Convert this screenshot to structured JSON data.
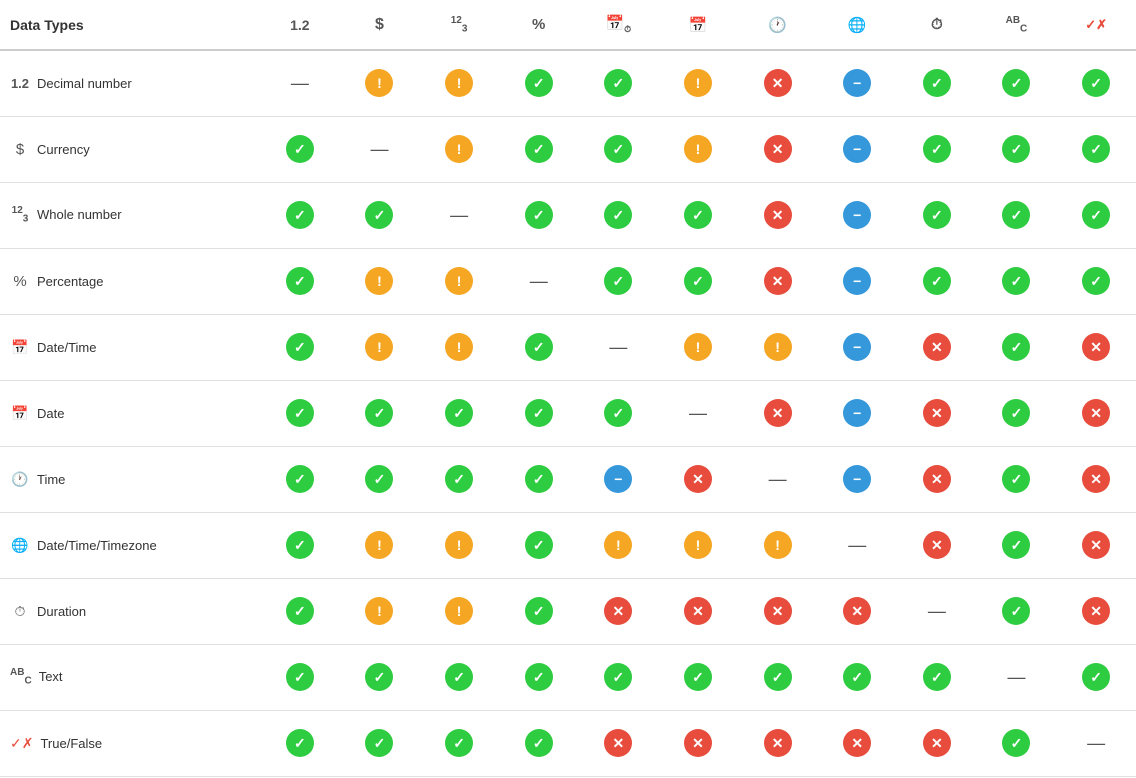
{
  "header": {
    "title": "Data Types",
    "columns": [
      {
        "id": "decimal",
        "label": "1.2",
        "icon": "1.2"
      },
      {
        "id": "currency",
        "label": "$",
        "icon": "$"
      },
      {
        "id": "whole",
        "label": "¹²₃",
        "icon": "123"
      },
      {
        "id": "percent",
        "label": "%",
        "icon": "%"
      },
      {
        "id": "datetime",
        "label": "🗓",
        "icon": "datetime"
      },
      {
        "id": "date",
        "label": "📅",
        "icon": "date"
      },
      {
        "id": "time",
        "label": "⏱",
        "icon": "time"
      },
      {
        "id": "tz",
        "label": "🌐",
        "icon": "tz"
      },
      {
        "id": "duration",
        "label": "⏱",
        "icon": "duration"
      },
      {
        "id": "text",
        "label": "ABC",
        "icon": "text"
      },
      {
        "id": "truefalse",
        "label": "✓✗",
        "icon": "truefalse"
      }
    ]
  },
  "rows": [
    {
      "id": "decimal",
      "icon": "decimal",
      "label": "Decimal number",
      "cells": [
        "dash",
        "yellow",
        "yellow",
        "green",
        "green",
        "yellow",
        "red",
        "blue",
        "green",
        "green",
        "green"
      ]
    },
    {
      "id": "currency",
      "icon": "currency",
      "label": "Currency",
      "cells": [
        "green",
        "dash",
        "yellow",
        "green",
        "green",
        "yellow",
        "red",
        "blue",
        "green",
        "green",
        "green"
      ]
    },
    {
      "id": "whole",
      "icon": "whole",
      "label": "Whole number",
      "cells": [
        "green",
        "green",
        "dash",
        "green",
        "green",
        "green",
        "red",
        "blue",
        "green",
        "green",
        "green"
      ]
    },
    {
      "id": "percentage",
      "icon": "percent",
      "label": "Percentage",
      "cells": [
        "green",
        "yellow",
        "yellow",
        "dash",
        "green",
        "green",
        "red",
        "blue",
        "green",
        "green",
        "green"
      ]
    },
    {
      "id": "datetime",
      "icon": "datetime",
      "label": "Date/Time",
      "cells": [
        "green",
        "yellow",
        "yellow",
        "green",
        "dash",
        "yellow",
        "yellow",
        "blue",
        "red",
        "green",
        "red"
      ]
    },
    {
      "id": "date",
      "icon": "date",
      "label": "Date",
      "cells": [
        "green",
        "green",
        "green",
        "green",
        "green",
        "dash",
        "red",
        "blue",
        "red",
        "green",
        "red"
      ]
    },
    {
      "id": "time",
      "icon": "time",
      "label": "Time",
      "cells": [
        "green",
        "green",
        "green",
        "green",
        "blue",
        "red",
        "dash",
        "blue",
        "red",
        "green",
        "red"
      ]
    },
    {
      "id": "tz",
      "icon": "tz",
      "label": "Date/Time/Timezone",
      "cells": [
        "green",
        "yellow",
        "yellow",
        "green",
        "yellow",
        "yellow",
        "yellow",
        "dash",
        "red",
        "green",
        "red"
      ]
    },
    {
      "id": "duration",
      "icon": "duration",
      "label": "Duration",
      "cells": [
        "green",
        "yellow",
        "yellow",
        "green",
        "red",
        "red",
        "red",
        "red",
        "dash",
        "green",
        "red"
      ]
    },
    {
      "id": "text",
      "icon": "text",
      "label": "Text",
      "cells": [
        "green",
        "green",
        "green",
        "green",
        "green",
        "green",
        "green",
        "green",
        "green",
        "dash",
        "green"
      ]
    },
    {
      "id": "truefalse",
      "icon": "truefalse",
      "label": "True/False",
      "cells": [
        "green",
        "green",
        "green",
        "green",
        "red",
        "red",
        "red",
        "red",
        "red",
        "green",
        "dash"
      ]
    }
  ],
  "cell_symbols": {
    "green": "✓",
    "yellow": "!",
    "red": "✕",
    "blue": "−",
    "dash": "—"
  }
}
